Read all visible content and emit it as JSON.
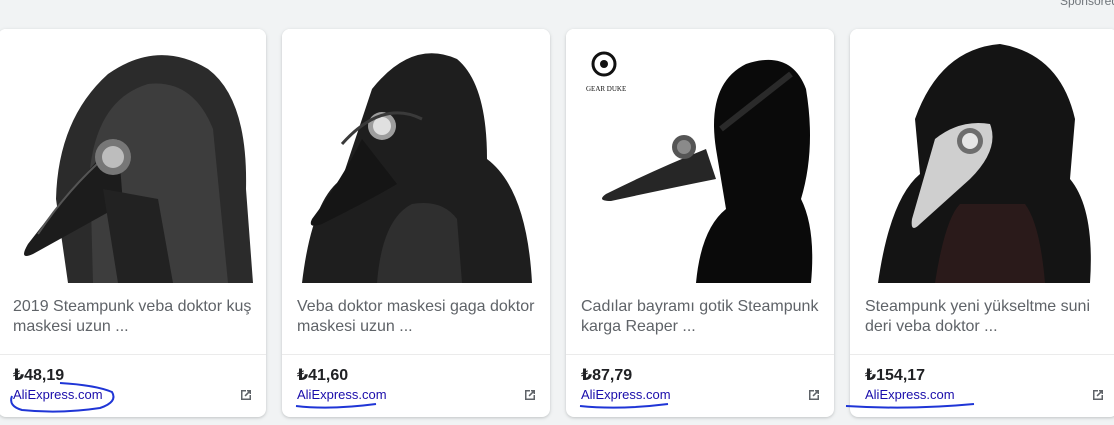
{
  "header": {
    "sponsored_label": "Sponsored"
  },
  "products": [
    {
      "title": "2019 Steampunk veba doktor kuş maskesi uzun ...",
      "price": "₺48,19",
      "merchant": "AliExpress.com",
      "icon": "external-link-icon"
    },
    {
      "title": "Veba doktor maskesi gaga doktor maskesi uzun ...",
      "price": "₺41,60",
      "merchant": "AliExpress.com",
      "icon": "external-link-icon"
    },
    {
      "title": "Cadılar bayramı gotik Steampunk karga Reaper ...",
      "price": "₺87,79",
      "merchant": "AliExpress.com",
      "icon": "external-link-icon",
      "logo_text": "GEAR DUKE"
    },
    {
      "title": "Steampunk yeni yükseltme suni deri veba doktor ...",
      "price": "₺154,17",
      "merchant": "AliExpress.com",
      "icon": "external-link-icon"
    }
  ],
  "colors": {
    "link": "#1a0dab",
    "annotation": "#1f35d6",
    "title": "#5f6368",
    "price": "#202124"
  }
}
